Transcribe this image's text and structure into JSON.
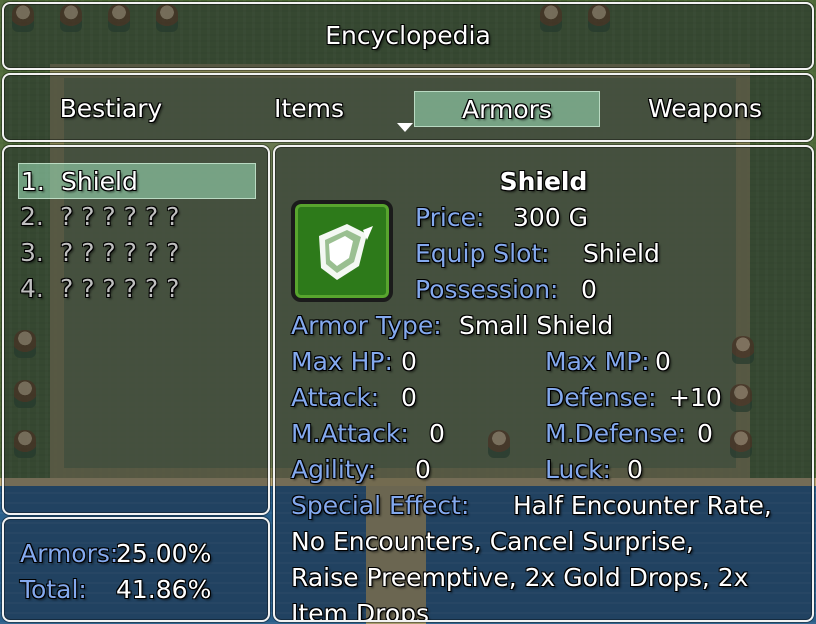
{
  "window_title": "Encyclopedia",
  "tabs": [
    {
      "label": "Bestiary"
    },
    {
      "label": "Items"
    },
    {
      "label": "Armors"
    },
    {
      "label": "Weapons"
    }
  ],
  "list": [
    {
      "num": "1.",
      "name": "Shield"
    },
    {
      "num": "2.",
      "name": "? ? ? ? ? ?"
    },
    {
      "num": "3.",
      "name": "? ? ? ? ? ?"
    },
    {
      "num": "4.",
      "name": "? ? ? ? ? ?"
    }
  ],
  "completion": {
    "armors_label": "Armors:",
    "armors_value": "25.00%",
    "total_label": "Total:",
    "total_value": "41.86%"
  },
  "detail": {
    "name": "Shield",
    "icon": "shield-icon",
    "price_label": "Price:",
    "price_value": "300 G",
    "slot_label": "Equip Slot:",
    "slot_value": "Shield",
    "possession_label": "Possession:",
    "possession_value": "0",
    "type_label": "Armor Type:",
    "type_value": "Small Shield",
    "maxhp_label": "Max HP:",
    "maxhp_value": "0",
    "maxmp_label": "Max MP:",
    "maxmp_value": "0",
    "attack_label": "Attack:",
    "attack_value": "0",
    "defense_label": "Defense:",
    "defense_value": "+10",
    "mattack_label": "M.Attack:",
    "mattack_value": "0",
    "mdefense_label": "M.Defense:",
    "mdefense_value": "0",
    "agility_label": "Agility:",
    "agility_value": "0",
    "luck_label": "Luck:",
    "luck_value": "0",
    "effect_label": "Special Effect:",
    "effect_line1": "Half Encounter Rate,",
    "effect_line2": "No Encounters, Cancel Surprise,",
    "effect_line3": "Raise Preemptive, 2x Gold Drops, 2x",
    "effect_line4": "Item Drops"
  },
  "colors": {
    "system_text": "#84a9ee",
    "selection_highlight": "#a0e6be",
    "icon_background": "#2d7a1a"
  }
}
